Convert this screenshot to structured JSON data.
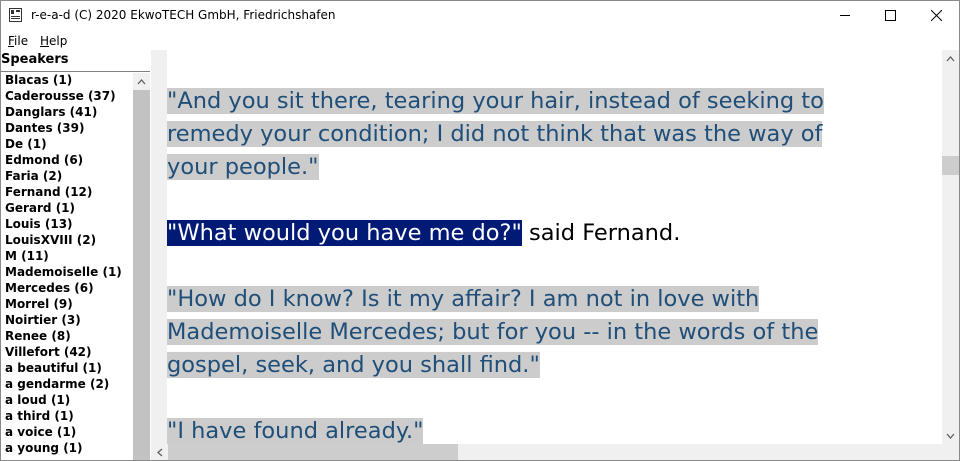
{
  "window": {
    "title": "r-e-a-d (C) 2020 EkwoTECH GmbH, Friedrichshafen"
  },
  "menu": [
    {
      "accel": "F",
      "rest": "ile"
    },
    {
      "accel": "H",
      "rest": "elp"
    }
  ],
  "sidebar": {
    "heading": "Speakers",
    "items": [
      "Blacas (1)",
      "Caderousse (37)",
      "Danglars (41)",
      "Dantes (39)",
      "De (1)",
      "Edmond (6)",
      "Faria (2)",
      "Fernand (12)",
      "Gerard (1)",
      "Louis (13)",
      "LouisXVIII (2)",
      "M (11)",
      "Mademoiselle (1)",
      "Mercedes (6)",
      "Morrel (9)",
      "Noirtier (3)",
      "Renee (8)",
      "Villefort (42)",
      "a beautiful (1)",
      "a gendarme (2)",
      "a loud (1)",
      "a third (1)",
      "a voice (1)",
      "a young (1)"
    ]
  },
  "text": {
    "p1": [
      "\"And you sit there, tearing your hair, instead of seeking to ",
      "remedy your condition; I did not think that was the way of ",
      "your people.\""
    ],
    "p2_quote": "\"What would you have me do?\"",
    "p2_tail": " said Fernand.",
    "p3": [
      "\"How do I know? Is it my affair? I am not in love with ",
      "Mademoiselle Mercedes; but for you -- in the words of the ",
      "gospel, seek, and you shall find.\""
    ],
    "p4": [
      "\"I have found already.\""
    ]
  },
  "colors": {
    "quote_text": "#1f4e79",
    "quote_highlight": "#cccccc",
    "selection": "#001a75"
  }
}
